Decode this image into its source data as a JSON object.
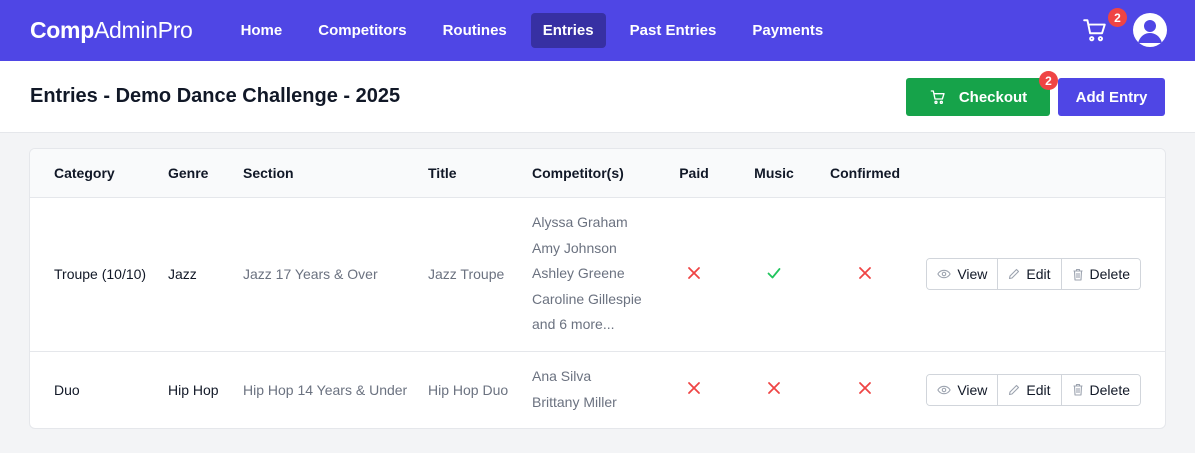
{
  "brand": {
    "bold": "Comp",
    "rest": "AdminPro"
  },
  "nav": {
    "items": [
      {
        "label": "Home",
        "active": false
      },
      {
        "label": "Competitors",
        "active": false
      },
      {
        "label": "Routines",
        "active": false
      },
      {
        "label": "Entries",
        "active": true
      },
      {
        "label": "Past Entries",
        "active": false
      },
      {
        "label": "Payments",
        "active": false
      }
    ],
    "cart_count": "2",
    "cart_icon": "shopping-cart-icon",
    "avatar_icon": "user-avatar-icon"
  },
  "header": {
    "title": "Entries - Demo Dance Challenge - 2025",
    "checkout_label": "Checkout",
    "checkout_count": "2",
    "add_label": "Add Entry"
  },
  "colors": {
    "primary": "#4f46e5",
    "success": "#16a34a",
    "danger": "#ef4444",
    "check": "#22c55e"
  },
  "table": {
    "columns": [
      "Category",
      "Genre",
      "Section",
      "Title",
      "Competitor(s)",
      "Paid",
      "Music",
      "Confirmed"
    ],
    "action_labels": {
      "view": "View",
      "edit": "Edit",
      "delete": "Delete"
    },
    "rows": [
      {
        "category": "Troupe (10/10)",
        "genre": "Jazz",
        "section": "Jazz 17 Years & Over",
        "title": "Jazz Troupe",
        "competitors": [
          "Alyssa Graham",
          "Amy Johnson",
          "Ashley Greene",
          "Caroline Gillespie",
          "and 6 more..."
        ],
        "paid": false,
        "music": true,
        "confirmed": false
      },
      {
        "category": "Duo",
        "genre": "Hip Hop",
        "section": "Hip Hop 14 Years & Under",
        "title": "Hip Hop Duo",
        "competitors": [
          "Ana Silva",
          "Brittany Miller"
        ],
        "paid": false,
        "music": false,
        "confirmed": false
      }
    ]
  }
}
